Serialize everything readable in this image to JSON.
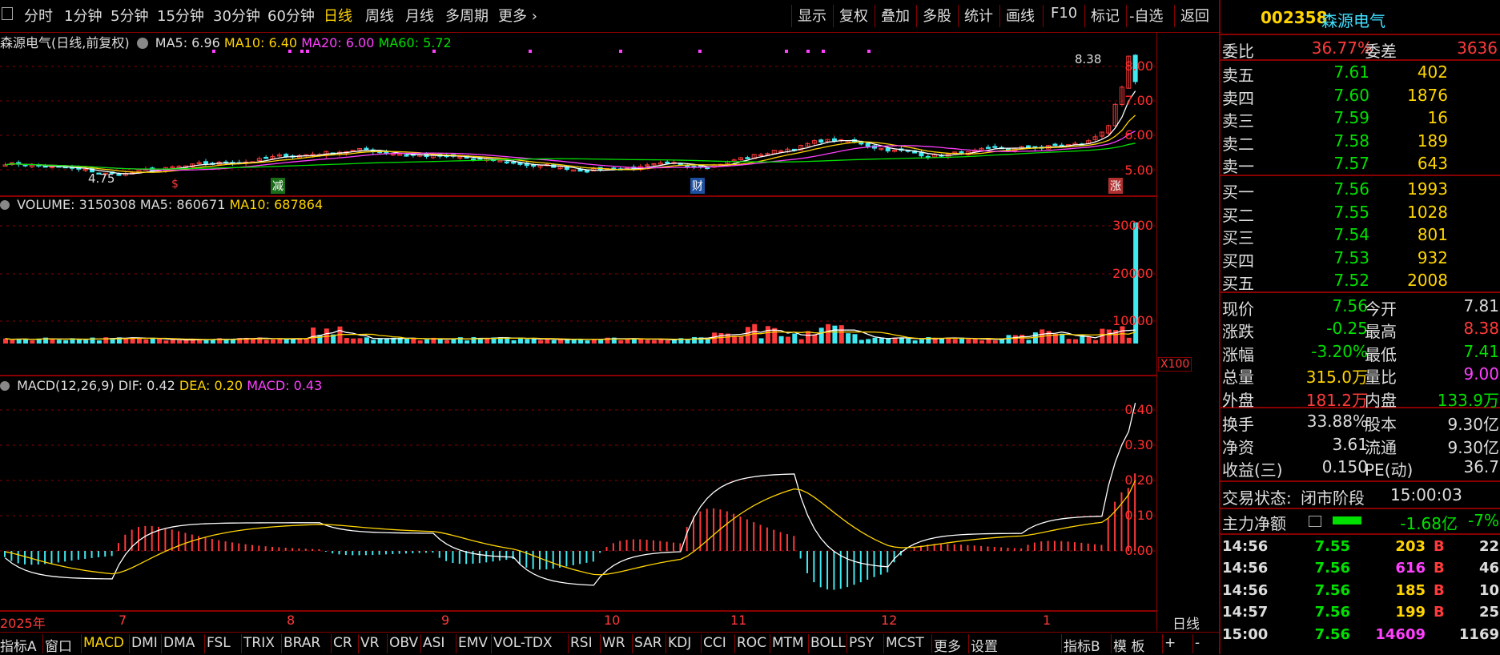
{
  "toolbar": {
    "left_items": [
      "分时",
      "1分钟",
      "5分钟",
      "15分钟",
      "30分钟",
      "60分钟",
      "日线",
      "周线",
      "月线",
      "多周期",
      "更多"
    ],
    "selected": "日线",
    "right_items": [
      "显示",
      "复权",
      "叠加",
      "多股",
      "统计",
      "画线",
      "F10",
      "标记",
      "-自选",
      "返回"
    ]
  },
  "price_panel": {
    "title": "森源电气(日线,前复权)",
    "ma5": "MA5: 6.96",
    "ma10": "MA10: 6.40",
    "ma20": "MA20: 6.00",
    "ma60": "MA60: 5.72",
    "y_ticks": [
      "8.00",
      "7.00",
      "6.00",
      "5.00"
    ],
    "high_label": "8.38",
    "low_label": "4.75",
    "markers": [
      "$",
      "减",
      "财",
      "涨"
    ]
  },
  "volume_panel": {
    "title": "VOLUME: 3150308",
    "ma5": "MA5: 860671",
    "ma10": "MA10: 687864",
    "y_ticks": [
      "30000",
      "20000",
      "10000"
    ],
    "unit": "X100"
  },
  "macd_panel": {
    "title": "MACD(12,26,9)",
    "dif": "DIF: 0.42",
    "dea": "DEA: 0.20",
    "macd": "MACD: 0.43",
    "y_ticks": [
      "0.40",
      "0.30",
      "0.20",
      "0.10",
      "0.00"
    ]
  },
  "x_axis": {
    "labels": [
      "2025年",
      "7",
      "8",
      "9",
      "10",
      "11",
      "12",
      "1"
    ],
    "period": "日线"
  },
  "bottom_tabs": {
    "items": [
      "指标A",
      "窗口",
      "MACD",
      "DMI",
      "DMA",
      "FSL",
      "TRIX",
      "BRAR",
      "CR",
      "VR",
      "OBV",
      "ASI",
      "EMV",
      "VOL-TDX",
      "RSI",
      "WR",
      "SAR",
      "KDJ",
      "CCI",
      "ROC",
      "MTM",
      "BOLL",
      "PSY",
      "MCST",
      "更多",
      "设置",
      "指标B",
      "模 板",
      "+",
      "-"
    ],
    "selected": "MACD"
  },
  "quote": {
    "code": "002358",
    "name": "森源电气",
    "weibi_label": "委比",
    "weibi": "36.77%",
    "weicha_label": "委差",
    "weicha": "3636",
    "asks": [
      {
        "label": "卖五",
        "price": "7.61",
        "vol": "402"
      },
      {
        "label": "卖四",
        "price": "7.60",
        "vol": "1876"
      },
      {
        "label": "卖三",
        "price": "7.59",
        "vol": "16"
      },
      {
        "label": "卖二",
        "price": "7.58",
        "vol": "189"
      },
      {
        "label": "卖一",
        "price": "7.57",
        "vol": "643"
      }
    ],
    "bids": [
      {
        "label": "买一",
        "price": "7.56",
        "vol": "1993"
      },
      {
        "label": "买二",
        "price": "7.55",
        "vol": "1028"
      },
      {
        "label": "买三",
        "price": "7.54",
        "vol": "801"
      },
      {
        "label": "买四",
        "price": "7.53",
        "vol": "932"
      },
      {
        "label": "买五",
        "price": "7.52",
        "vol": "2008"
      }
    ],
    "stats": [
      {
        "l1": "现价",
        "v1": "7.56",
        "c1": "g",
        "l2": "今开",
        "v2": "7.81",
        "c2": "w"
      },
      {
        "l1": "涨跌",
        "v1": "-0.25",
        "c1": "g",
        "l2": "最高",
        "v2": "8.38",
        "c2": "r"
      },
      {
        "l1": "涨幅",
        "v1": "-3.20%",
        "c1": "g",
        "l2": "最低",
        "v2": "7.41",
        "c2": "g"
      },
      {
        "l1": "总量",
        "v1": "315.0万",
        "c1": "y",
        "l2": "量比",
        "v2": "9.00",
        "c2": "m"
      },
      {
        "l1": "外盘",
        "v1": "181.2万",
        "c1": "r",
        "l2": "内盘",
        "v2": "133.9万",
        "c2": "g"
      }
    ],
    "stats2": [
      {
        "l1": "换手",
        "v1": "33.88%",
        "l2": "股本",
        "v2": "9.30亿"
      },
      {
        "l1": "净资",
        "v1": "3.61",
        "l2": "流通",
        "v2": "9.30亿"
      },
      {
        "l1": "收益(三)",
        "v1": "0.150",
        "l2": "PE(动)",
        "v2": "36.7"
      }
    ],
    "status_label": "交易状态:",
    "status_value": "闭市阶段",
    "status_time": "15:00:03",
    "net_label": "主力净额",
    "net_value": "-1.68亿",
    "net_pct": "-7%",
    "ticks": [
      {
        "time": "14:56",
        "price": "7.55",
        "vol": "203",
        "vc": "y",
        "bs": "B",
        "n": "22"
      },
      {
        "time": "14:56",
        "price": "7.56",
        "vol": "616",
        "vc": "m",
        "bs": "B",
        "n": "46"
      },
      {
        "time": "14:56",
        "price": "7.56",
        "vol": "185",
        "vc": "y",
        "bs": "B",
        "n": "10"
      },
      {
        "time": "14:57",
        "price": "7.56",
        "vol": "199",
        "vc": "y",
        "bs": "B",
        "n": "25"
      },
      {
        "time": "15:00",
        "price": "7.56",
        "vol": "14609",
        "vc": "m",
        "bs": "",
        "n": "1169"
      }
    ]
  },
  "colors": {
    "up": "#ff3a3a",
    "down": "#40e8f0",
    "ma5": "#ffffff",
    "ma10": "#ffd400",
    "ma20": "#ff40ff",
    "ma60": "#00e000",
    "grid": "#8a0000"
  }
}
